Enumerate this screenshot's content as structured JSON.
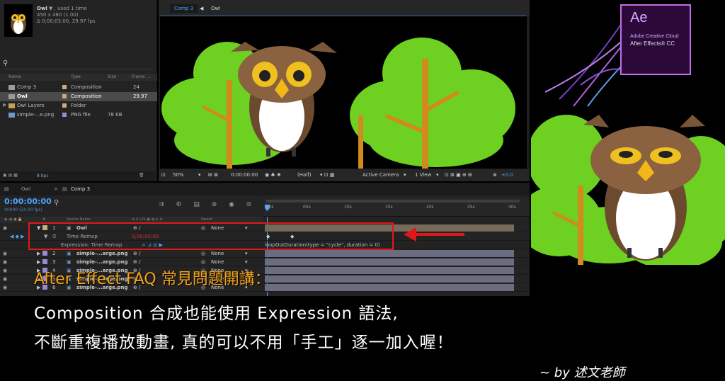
{
  "project": {
    "item_name": "Owl",
    "usage": ", used 1 time",
    "dims": "450 x 480 (1.00)",
    "duration": "Δ 0;00;03;00, 29.97 fps",
    "search_icon": "search-icon",
    "columns": [
      "Name",
      "Type",
      "Size",
      "Frame ..."
    ],
    "items": [
      {
        "name": "Comp 3",
        "type": "Composition",
        "size": "",
        "frame": "24",
        "color": "#c8b070"
      },
      {
        "name": "Owl",
        "type": "Composition",
        "size": "",
        "frame": "29.97",
        "color": "#c8b070"
      },
      {
        "name": "Owl Layers",
        "type": "Folder",
        "size": "",
        "frame": "",
        "color": "#c8b070"
      },
      {
        "name": "simple-...e.png",
        "type": "PNG file",
        "size": "78 KB",
        "frame": "",
        "color": "#9a8ad0"
      }
    ],
    "bpc": "8 bpc"
  },
  "viewer": {
    "tab": "Comp 3",
    "crumb": "Owl",
    "zoom": "50%",
    "timecode": "0:00:00:00",
    "resolution": "(Half)",
    "camera": "Active Camera",
    "views": "1 View",
    "exposure": "+0.0"
  },
  "timeline": {
    "tabs": [
      "Owl",
      "Comp 3"
    ],
    "time": "0:00:00:00",
    "fps": "00000 (24.00 fps)",
    "headers": {
      "num": "#",
      "source": "Source Name",
      "parent": "Parent"
    },
    "ruler": [
      "00s",
      "05s",
      "10s",
      "15s",
      "20s",
      "25s",
      "30s"
    ],
    "layer1": {
      "num": "1",
      "name": "Owl",
      "parent": "None"
    },
    "time_remap": {
      "label": "Time Remap",
      "value": "0;00;00;00"
    },
    "expression": {
      "label": "Expression: Time Remap",
      "code": "loopOutDuration(type = \"cycle\", duration = 0)"
    },
    "layers": [
      {
        "num": "2",
        "name": "simple-...arge.png",
        "parent": "None"
      },
      {
        "num": "3",
        "name": "simple-...arge.png",
        "parent": "None"
      },
      {
        "num": "4",
        "name": "simple-...arge.png",
        "parent": "None"
      },
      {
        "num": "5",
        "name": "simple-...arge.png",
        "parent": "None"
      },
      {
        "num": "6",
        "name": "simple-...arge.png",
        "parent": "None"
      }
    ]
  },
  "ae_logo": {
    "abbr": "Ae",
    "sub": "Adobe Creative Cloud",
    "product": "After Effects® CC"
  },
  "caption": {
    "title": "After Effect FAQ 常見問題開講：",
    "line1": "Composition 合成也能使用 Expression 語法,",
    "line2": "不斷重複播放動畫, 真的可以不用「手工」逐一加入喔！",
    "byline": "~ by 述文老師"
  },
  "colors": {
    "accent_blue": "#4aa5ff",
    "highlight_red": "#e01818",
    "caption_orange": "#f2a31a",
    "tree_green": "#6ed020"
  }
}
